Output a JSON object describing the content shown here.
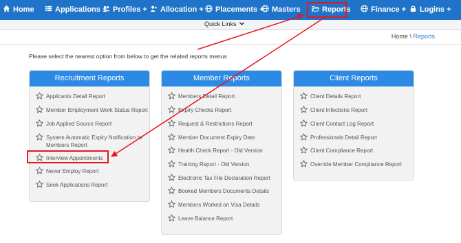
{
  "nav": {
    "home": "Home",
    "applications": "Applications +",
    "profiles": "Profiles +",
    "allocation": "Allocation +",
    "placements": "Placements +",
    "masters": "Masters",
    "reports": "Reports",
    "finance": "Finance +",
    "logins": "Logins +"
  },
  "quick_links": "Quick Links",
  "breadcrumb": {
    "home": "Home",
    "separator": "\\",
    "current": "Reports"
  },
  "intro": "Please select the nearest option from below to get the related reports menus",
  "panels": [
    {
      "title": "Recruitment Reports",
      "items": [
        "Applicants Detail Report",
        "Member Employment Work Status Report",
        "Job Applied Source Report",
        "System Automatic Expiry Notification to Members Report",
        "Interview Appointments",
        "Never Employ Report",
        "Seek Applications Report"
      ]
    },
    {
      "title": "Member Reports",
      "items": [
        "Members Detail Report",
        "Expiry Checks Report",
        "Request & Restrictions Report",
        "Member Document Expiry Date",
        "Health Check Report - Old Version",
        "Training Report - Old Version",
        "Electronic Tax File Declaration Report",
        "Booked Members Documents Details",
        "Members Worked on Visa Details",
        "Leave Balance Report"
      ]
    },
    {
      "title": "Client Reports",
      "items": [
        "Client Details Report",
        "Client Infections Report",
        "Client Contact Log Report",
        "Professionals Detail Report",
        "Client Compliance Report",
        "Override Member Compliance Report"
      ]
    }
  ],
  "colors": {
    "nav_bg": "#1f74c9",
    "panel_header": "#2d8ae4",
    "highlight": "#e5171b",
    "breadcrumb_active": "#2a7fd1"
  },
  "icons": {
    "home": "home-icon",
    "applications": "list-icon",
    "profiles": "users-icon",
    "allocation": "user-add-icon",
    "placements": "globe-icon",
    "masters": "globe-icon",
    "reports": "folder-open-icon",
    "finance": "globe-icon",
    "logins": "lock-icon",
    "report_item": "star-outline-icon"
  }
}
